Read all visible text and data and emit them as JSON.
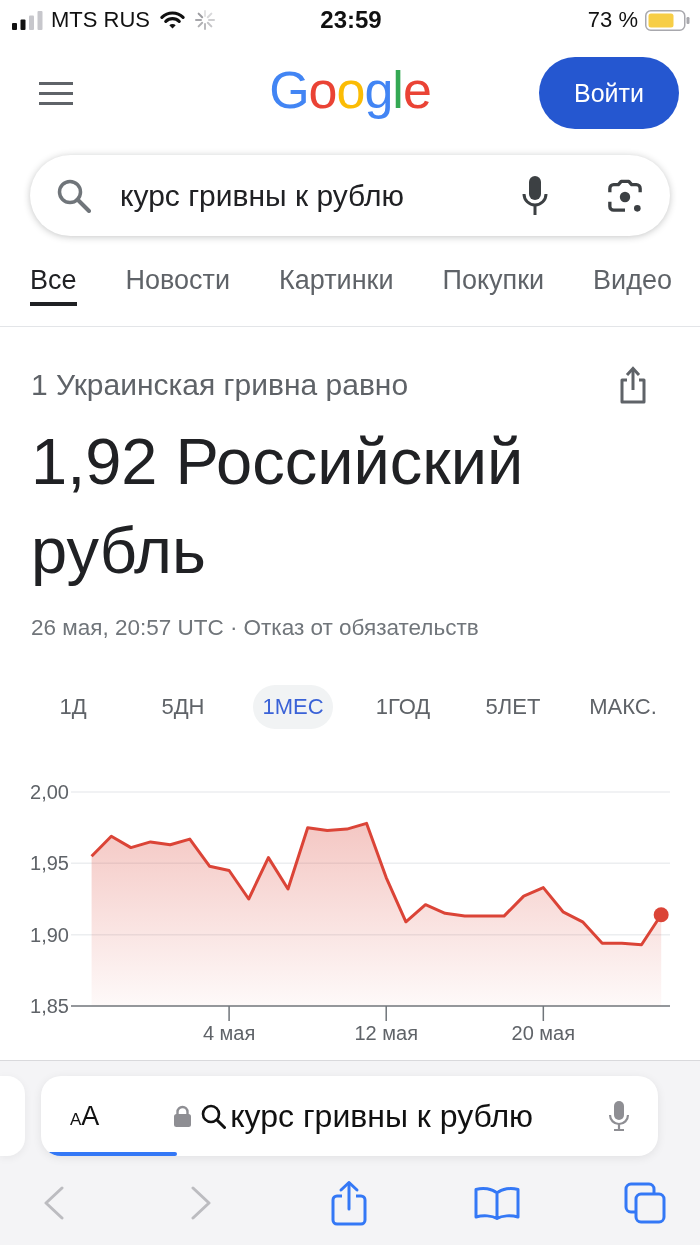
{
  "status_bar": {
    "carrier": "MTS RUS",
    "time": "23:59",
    "battery": "73 %"
  },
  "header": {
    "logo": "Google",
    "sign_in": "Войти"
  },
  "search": {
    "value": "курс гривны к рублю"
  },
  "tabs": [
    {
      "label": "Все",
      "selected": true
    },
    {
      "label": "Новости",
      "selected": false
    },
    {
      "label": "Картинки",
      "selected": false
    },
    {
      "label": "Покупки",
      "selected": false
    },
    {
      "label": "Видео",
      "selected": false
    }
  ],
  "converter": {
    "caption": "1 Украинская гривна равно",
    "result": "1,92 Российский рубль",
    "timestamp": "26 мая, 20:57 UTC ·",
    "disclaimer": "Отказ от обязательств",
    "ranges": [
      {
        "label": "1Д",
        "selected": false
      },
      {
        "label": "5ДН",
        "selected": false
      },
      {
        "label": "1МЕС",
        "selected": true
      },
      {
        "label": "1ГОД",
        "selected": false
      },
      {
        "label": "5ЛЕТ",
        "selected": false
      },
      {
        "label": "МАКС.",
        "selected": false
      }
    ],
    "chart_data": {
      "type": "area",
      "categories": [
        null,
        null,
        null,
        null,
        null,
        null,
        null,
        "4 мая",
        null,
        null,
        null,
        null,
        null,
        null,
        null,
        "12 мая",
        null,
        null,
        null,
        null,
        null,
        null,
        null,
        "20 мая",
        null,
        null,
        null,
        null,
        null,
        null
      ],
      "series": [
        {
          "color": "#db4437",
          "values": [
            1.955,
            1.969,
            1.961,
            1.965,
            1.963,
            1.967,
            1.948,
            1.945,
            1.925,
            1.954,
            1.932,
            1.975,
            1.973,
            1.974,
            1.978,
            1.94,
            1.909,
            1.921,
            1.915,
            1.913,
            1.913,
            1.913,
            1.927,
            1.933,
            1.916,
            1.909,
            1.894,
            1.894,
            1.893,
            1.914
          ]
        }
      ],
      "ylim": [
        1.85,
        2.0
      ],
      "yticks": [
        {
          "value": 1.85,
          "label": "1,85"
        },
        {
          "value": 1.9,
          "label": "1,90"
        },
        {
          "value": 1.95,
          "label": "1,95"
        },
        {
          "value": 2.0,
          "label": "2,00"
        }
      ]
    }
  },
  "browser": {
    "reader_button": "AA",
    "address": "курс гривны к рублю",
    "load": {
      "level": 0.22
    },
    "toolbar": [
      {
        "kind": "back",
        "disabled": true
      },
      {
        "kind": "forward",
        "disabled": true
      },
      {
        "kind": "share",
        "disabled": false
      },
      {
        "kind": "bookmarks",
        "disabled": false
      },
      {
        "kind": "tabs",
        "disabled": false
      }
    ]
  }
}
